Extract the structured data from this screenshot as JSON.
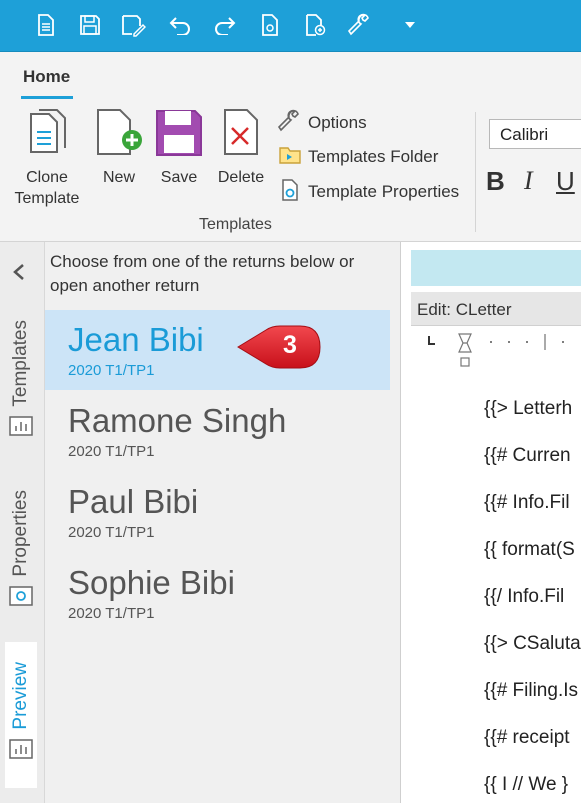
{
  "ribbon": {
    "tab_home": "Home",
    "group_label": "Templates",
    "buttons": {
      "clone": "Clone Template",
      "new": "New",
      "save": "Save",
      "delete": "Delete"
    },
    "small": {
      "options": "Options",
      "templates_folder": "Templates Folder",
      "template_properties": "Template Properties"
    },
    "font": "Calibri",
    "format": {
      "bold": "B",
      "italic": "I",
      "underline": "U"
    }
  },
  "side_tabs": {
    "templates": "Templates",
    "properties": "Properties",
    "preview": "Preview"
  },
  "list": {
    "header": "Choose from one of the returns below or open another return",
    "returns": [
      {
        "name": "Jean Bibi",
        "year": "2020 T1/TP1"
      },
      {
        "name": "Ramone Singh",
        "year": "2020 T1/TP1"
      },
      {
        "name": "Paul Bibi",
        "year": "2020 T1/TP1"
      },
      {
        "name": "Sophie Bibi",
        "year": "2020 T1/TP1"
      }
    ]
  },
  "callout": "3",
  "editor": {
    "header": "Edit: CLetter",
    "lines": [
      "{{> Letterh",
      "{{# Curren",
      "{{# Info.Fil",
      "{{ format(S",
      "{{/ Info.Fil",
      "{{> CSaluta",
      "{{# Filing.Is",
      "{{# receipt",
      "{{ I // We }"
    ]
  },
  "colors": {
    "accent": "#1ea0d8",
    "selected_bg": "#cce4f7",
    "callout": "#e0171f"
  }
}
